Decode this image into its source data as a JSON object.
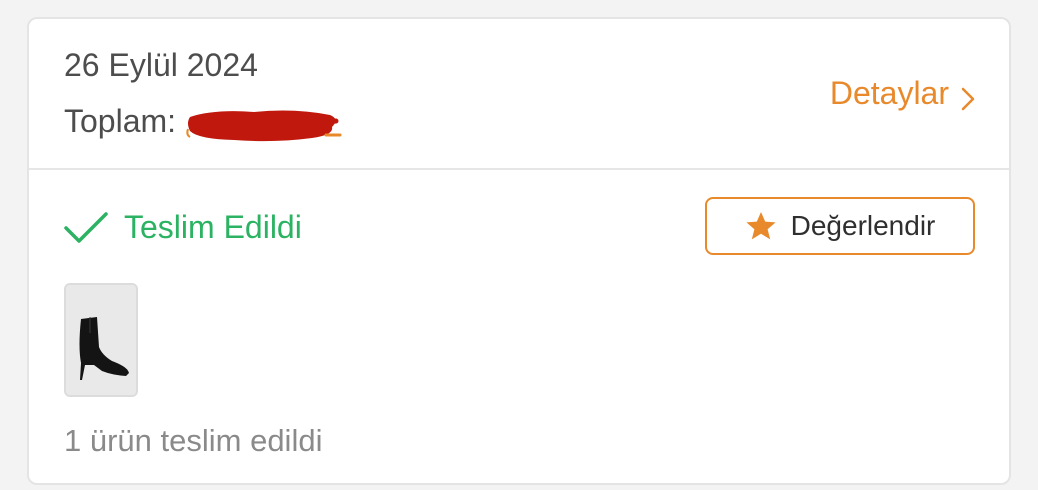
{
  "order": {
    "date": "26 Eylül 2024",
    "total_label": "Toplam:",
    "total_value_redacted": true
  },
  "header": {
    "details_label": "Detaylar"
  },
  "status": {
    "label": "Teslim Edildi",
    "color": "#2bb262"
  },
  "actions": {
    "rate_label": "Değerlendir"
  },
  "product": {
    "thumbnail_icon": "ankle-boot-image"
  },
  "summary": {
    "delivered_count_text": "1 ürün teslim edildi"
  },
  "colors": {
    "accent": "#e8892c",
    "success": "#2bb262",
    "redaction": "#c0180c"
  }
}
